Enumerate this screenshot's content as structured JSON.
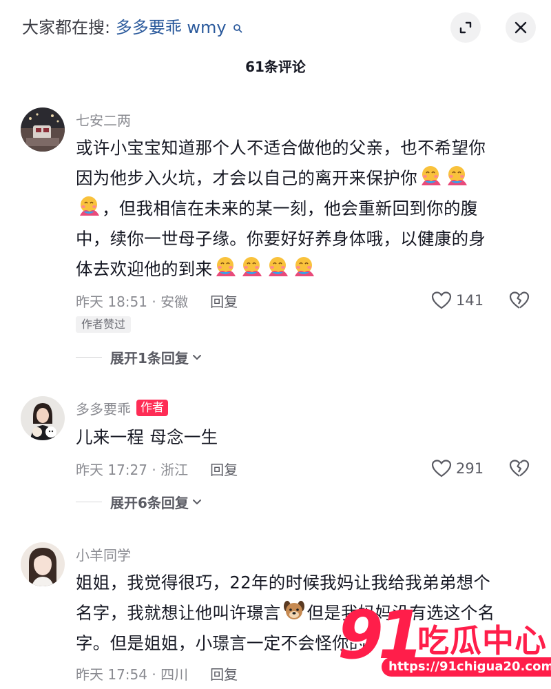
{
  "header": {
    "search_prefix": "大家都在搜:",
    "search_term": "多多要乖 wmy",
    "comment_count": "61条评论"
  },
  "comments": [
    {
      "author": "七安二两",
      "body_lines": [
        "或许小宝宝知道那个人不适合做他的父亲，也不希望你",
        "因为他步入火坑，才会以自己的离开来保护你",
        "，但我相信在未来的某一刻，他会重新回到你的腹",
        "中，续你一世母子缘。你要好好养身体哦，以健康的身",
        "体去欢迎他的到来"
      ],
      "emoji": "smiling-face-with-hearts-hug",
      "meta": "昨天 18:51 · 安徽",
      "reply": "回复",
      "likes": "141",
      "author_liked": "作者赞过",
      "expand": "展开1条回复"
    },
    {
      "author": "多多要乖",
      "author_badge": "作者",
      "body": "儿来一程 母念一生",
      "meta": "昨天 17:27 · 浙江",
      "reply": "回复",
      "likes": "291",
      "expand": "展开6条回复"
    },
    {
      "author": "小羊同学",
      "body_lines": [
        "姐姐，我觉得很巧，22年的时候我妈让我给我弟弟想个",
        "名字，我就想让他叫许璟言",
        "但是我妈妈没有选这个名",
        "字。但是姐姐，小璟言一定不会怪你的"
      ],
      "emoji_dog": "dog-face",
      "meta": "昨天 17:54 · 四川",
      "reply": "回复"
    }
  ],
  "watermark": {
    "number": "91",
    "name": "吃瓜中心",
    "url": "https://91chigua20.com"
  },
  "colors": {
    "accent_red": "#fe2c55",
    "link_blue": "#2b5a9c",
    "meta_gray": "#8a8b91"
  }
}
